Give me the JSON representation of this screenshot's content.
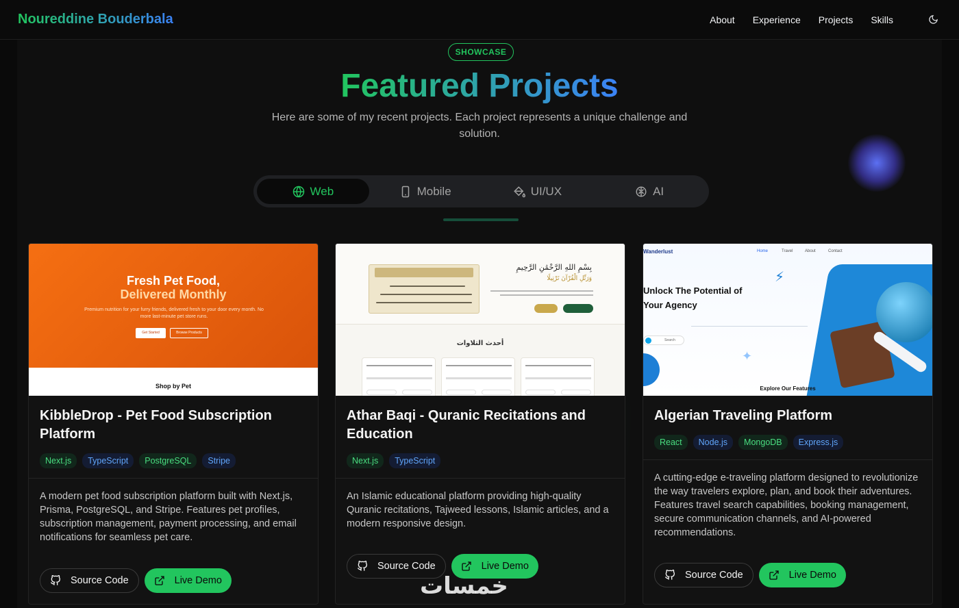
{
  "nav": {
    "brand": "Noureddine Bouderbala",
    "links": [
      "About",
      "Experience",
      "Projects",
      "Skills"
    ],
    "theme_icon": "moon-icon"
  },
  "section": {
    "badge": "SHOWCASE",
    "title": "Featured Projects",
    "subtitle": "Here are some of my recent projects. Each project represents a unique challenge and solution."
  },
  "tabs": [
    {
      "label": "Web",
      "icon": "globe-icon",
      "active": true
    },
    {
      "label": "Mobile",
      "icon": "smartphone-icon",
      "active": false
    },
    {
      "label": "UI/UX",
      "icon": "paint-bucket-icon",
      "active": false
    },
    {
      "label": "AI",
      "icon": "brain-icon",
      "active": false
    }
  ],
  "projects": [
    {
      "title": "KibbleDrop - Pet Food Subscription Platform",
      "tags": [
        "Next.js",
        "TypeScript",
        "PostgreSQL",
        "Stripe"
      ],
      "description": "A modern pet food subscription platform built with Next.js, Prisma, PostgreSQL, and Stripe. Features pet profiles, subscription management, payment processing, and email notifications for seamless pet care.",
      "source_label": "Source Code",
      "demo_label": "Live Demo",
      "preview": {
        "headline_1": "Fresh Pet Food,",
        "headline_2": "Delivered Monthly",
        "text": "Premium nutrition for your furry friends, delivered fresh to your door every month. No more last-minute pet store runs.",
        "btn_1": "Get Started",
        "btn_2": "Browse Products",
        "section": "Shop by Pet"
      }
    },
    {
      "title": "Athar Baqi - Quranic Recitations and Education",
      "tags": [
        "Next.js",
        "TypeScript"
      ],
      "description": "An Islamic educational platform providing high-quality Quranic recitations, Tajweed lessons, Islamic articles, and a modern responsive design.",
      "source_label": "Source Code",
      "demo_label": "Live Demo",
      "preview": {
        "heading": "بِسْمِ اللهِ الرَّحْمَٰنِ الرَّحِيمِ",
        "subheading": "وَرَتِّلِ الْقُرْآنَ تَرْتِيلًا",
        "section": "أحدث التلاوات"
      }
    },
    {
      "title": "Algerian Traveling Platform",
      "tags": [
        "React",
        "Node.js",
        "MongoDB",
        "Express.js"
      ],
      "description": "A cutting-edge e-traveling platform designed to revolutionize the way travelers explore, plan, and book their adventures. Features travel search capabilities, booking management, secure communication channels, and AI-powered recommendations.",
      "source_label": "Source Code",
      "demo_label": "Live Demo",
      "preview": {
        "logo": "Wanderlust",
        "nav": [
          "Home",
          "Travel",
          "About",
          "Contact"
        ],
        "headline": "Unlock The Potential of Your Agency",
        "search": "Search",
        "section": "Explore Our Features"
      }
    }
  ],
  "watermark": "خمسات",
  "colors": {
    "accent_green": "#22c55e",
    "accent_blue": "#3b82f6",
    "background": "#0a0a0a"
  }
}
